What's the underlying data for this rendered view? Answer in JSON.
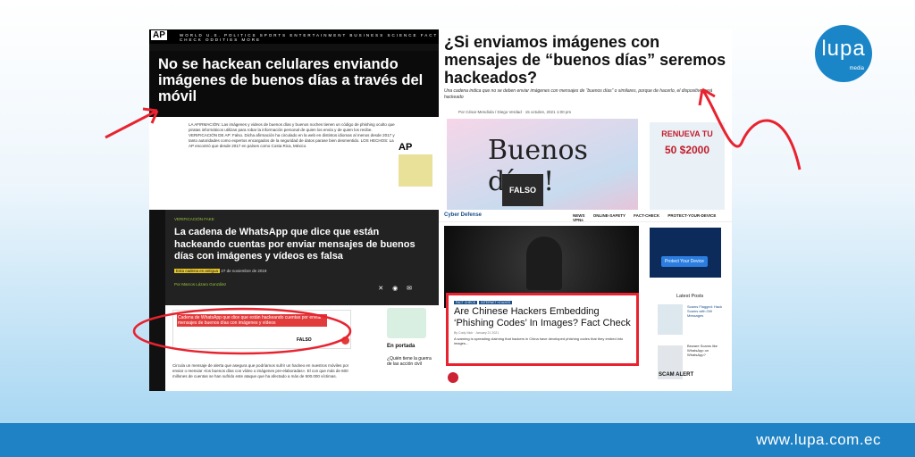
{
  "brand": {
    "logo_text": "lupa",
    "logo_sub": "media",
    "url": "www.lupa.com.ec"
  },
  "ap": {
    "logo": "AP",
    "nav": "WORLD  U.S.  POLITICS  SPORTS  ENTERTAINMENT  BUSINESS  SCIENCE  FACT CHECK  ODDITIES  MORE",
    "headline": "No se hackean celulares enviando imágenes de buenos días a través del móvil",
    "body": "LA AFIRMACIÓN: Las imágenes y videos de buenos días y buenos noches tienen un código de phishing oculto que piratas informáticos utilizan para robar la información personal de quien los envía y de quien los recibe. VERIFICACIÓN DE AP: Falso. Dicha afirmación ha circulado en la web en distintos idiomas al menos desde 2017 y tanto autoridades como expertos encargados de la seguridad de datos parase bien desmentido. LOS HECHOS: La AP encontró que desde 2017 en países como Costa Rica, México.",
    "ad_logo": "AP"
  },
  "p2": {
    "headline": "¿Si enviamos imágenes con mensajes de “buenos días” seremos hackeados?",
    "subtitle": "Una cadena indica que no se deben enviar imágenes con mensajes de “buenos días” o similares, porque de hacerlo, el dispositivo será hackeado",
    "author": "Por César Mendiola / Diego Verdad · 15 octubre, 2021 1:00 pm",
    "image_text": "Buenos días!",
    "falso": "FALSO",
    "ad_title": "RENUEVA TU",
    "ad_amount": "50 $2000"
  },
  "p3": {
    "tag": "VERIFICACIÓN  FAKE",
    "headline": "La cadena de WhatsApp que dice que están hackeando cuentas por enviar mensajes de buenos días con imágenes y vídeos es falsa",
    "meta_badge": "Esta cadena es antigua",
    "date": "27 de noviembre de 2019",
    "author": "Por Marcos Lázaro González",
    "card_text": "Cadena de WhatsApp que dice que están hackeando cuentas por enviar mensajes de buenos días con imágenes y vídeos",
    "card_label": "FALSO",
    "body": "Circula un mensaje de alerta que asegura que podríamos sufrir un hackeo en nuestros móviles por enviar o reenviar «los buenos días con vídeo o imágenes pre-elaboradas». El con que más de 600 millones de cuentas se han sufrido este ataque que ha afectado a más de 500.000 víctimas.",
    "en_portada": "En portada",
    "right_text": "¿Quién tiene la guerra de las acción civil"
  },
  "p4": {
    "logo": "Cyber Defense",
    "nav": "NEWS ONLINE-SAFETY FACT-CHECK PROTECT-YOUR-DEVICE VPNs",
    "tags": [
      "FACT CHECK",
      "INTERNET HOAXES"
    ],
    "headline": "Are Chinese Hackers Embedding ‘Phishing Codes’ In Images? Fact Check",
    "meta": "By Cody Nick · January 21 2021",
    "text": "A warning is spreading claiming that hackers in China have developed phishing codes that they embed into images...",
    "protect_btn": "Protect Your Device",
    "latest": "Latest Posts",
    "post1": "Scams Flagged: Hack Scams with Gift Messages",
    "post2": "Beware Scams like WhatsApp on WhatsApp?",
    "scam": "SCAM ALERT"
  }
}
